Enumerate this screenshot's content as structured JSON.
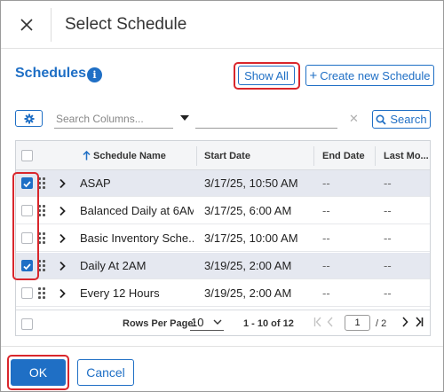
{
  "dialog": {
    "title": "Select Schedule",
    "close_icon": "close-icon"
  },
  "section": {
    "title": "Schedules",
    "info_glyph": "i"
  },
  "toolbar": {
    "show_all": "Show All",
    "create_label": "Create new Schedule",
    "create_prefix": "+"
  },
  "search": {
    "columns_placeholder": "Search Columns...",
    "value": "",
    "clear_glyph": "✕",
    "button_label": "Search"
  },
  "table": {
    "columns": [
      "Schedule Name",
      "Start Date",
      "End Date",
      "Last Mo..."
    ],
    "rows": [
      {
        "checked": true,
        "name": "ASAP",
        "start": "3/17/25, 10:50 AM",
        "end": "--",
        "last": "--"
      },
      {
        "checked": false,
        "name": "Balanced Daily at 6AM",
        "start": "3/17/25, 6:00 AM",
        "end": "--",
        "last": "--"
      },
      {
        "checked": false,
        "name": "Basic Inventory Sche...",
        "start": "3/17/25, 10:00 AM",
        "end": "--",
        "last": "--"
      },
      {
        "checked": true,
        "name": "Daily At 2AM",
        "start": "3/19/25, 2:00 AM",
        "end": "--",
        "last": "--"
      },
      {
        "checked": false,
        "name": "Every 12 Hours",
        "start": "3/19/25, 2:00 AM",
        "end": "--",
        "last": "--"
      }
    ]
  },
  "pagination": {
    "rows_per_page_label": "Rows Per Page:",
    "rows_per_page": "10",
    "range": "1 - 10 of 12",
    "page": "1",
    "of_pages": "/ 2"
  },
  "footer": {
    "ok": "OK",
    "cancel": "Cancel"
  },
  "colors": {
    "accent": "#1f6fc5",
    "highlight": "#d9262c",
    "selected_row": "#e5e8f0"
  }
}
